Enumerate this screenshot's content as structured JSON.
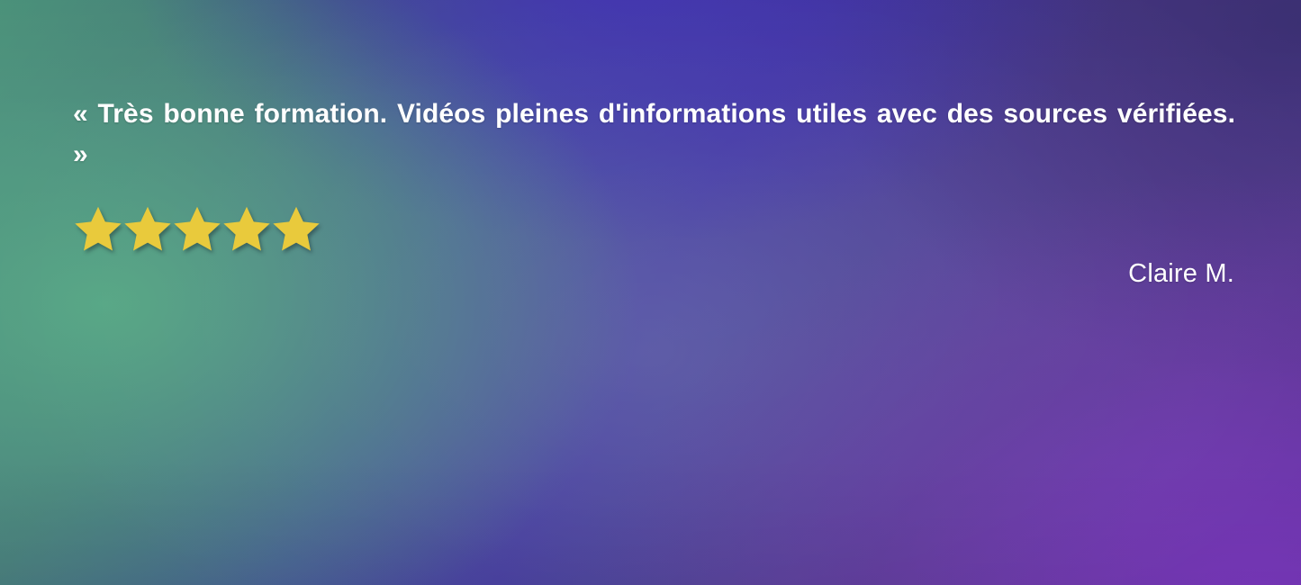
{
  "slide": {
    "background": {
      "green_accent": "#58a883",
      "blue_accent": "#4534bc",
      "indigo_corner": "#3a3074",
      "violet_accent": "#7e38c4",
      "center_blend": "#6870a8"
    }
  },
  "testimonial": {
    "quote": "« Très bonne formation. Vidéos pleines d'informations utiles avec des sources vérifiées. »",
    "author": "Claire M.",
    "rating": {
      "value": 5,
      "max": 5,
      "icon": "star-icon",
      "color": "#e9ca3c",
      "items": [
        {
          "index": 1,
          "filled": true
        },
        {
          "index": 2,
          "filled": true
        },
        {
          "index": 3,
          "filled": true
        },
        {
          "index": 4,
          "filled": true
        },
        {
          "index": 5,
          "filled": true
        }
      ]
    },
    "text_color": "#ffffff"
  }
}
